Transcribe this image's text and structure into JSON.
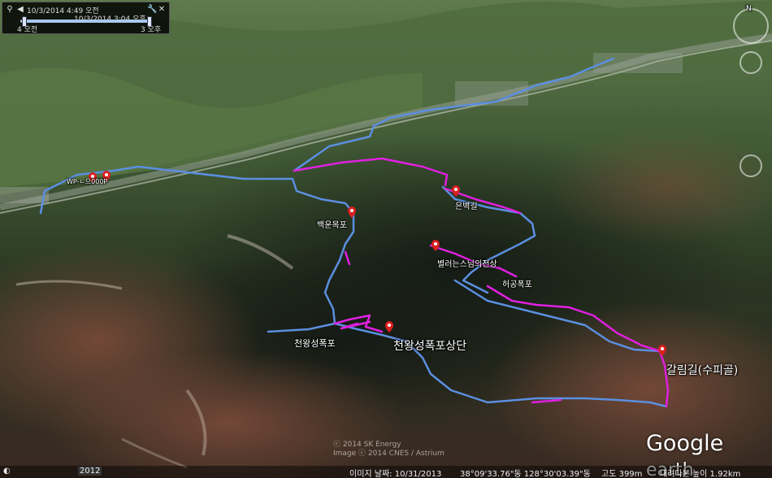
{
  "time_slider": {
    "zoom_in_icon": "zoom-in-icon",
    "current": "10/3/2014  4:49 오전",
    "range_label": "10/3/2014   3:04 오후",
    "start": "4 오전",
    "end": "3 오후",
    "close_icon": "close-icon",
    "settings_icon": "wrench-icon"
  },
  "labels": {
    "gate": "WP-ㄴ으000P",
    "baekneung": "백운목포",
    "eunbyeolgol": "은벽길",
    "cheongdam": "별러는스님의전상",
    "heogong": "허공폭포",
    "cheonwang_falls": "천왕성폭포",
    "cheonwang_upper": "천왕성폭포상단",
    "galrim": "갈림길(수피골)"
  },
  "copyright": {
    "line1": "ⓒ 2014 SK Energy",
    "line2": "Image ⓒ 2014 CNES / Astrium"
  },
  "brand": {
    "google": "Google",
    "earth": "earth"
  },
  "status": {
    "badge": "2012",
    "date": "이미지 날짜: 10/31/2013",
    "coords": "38°09'33.76\"동 128°30'03.39\"동",
    "elev": "고도  399m",
    "eye": "내려다본 높이  1.92km"
  },
  "colors": {
    "blue_track": "#5b8fe0",
    "magenta_track": "#e020e0",
    "marker": "#d92020"
  }
}
